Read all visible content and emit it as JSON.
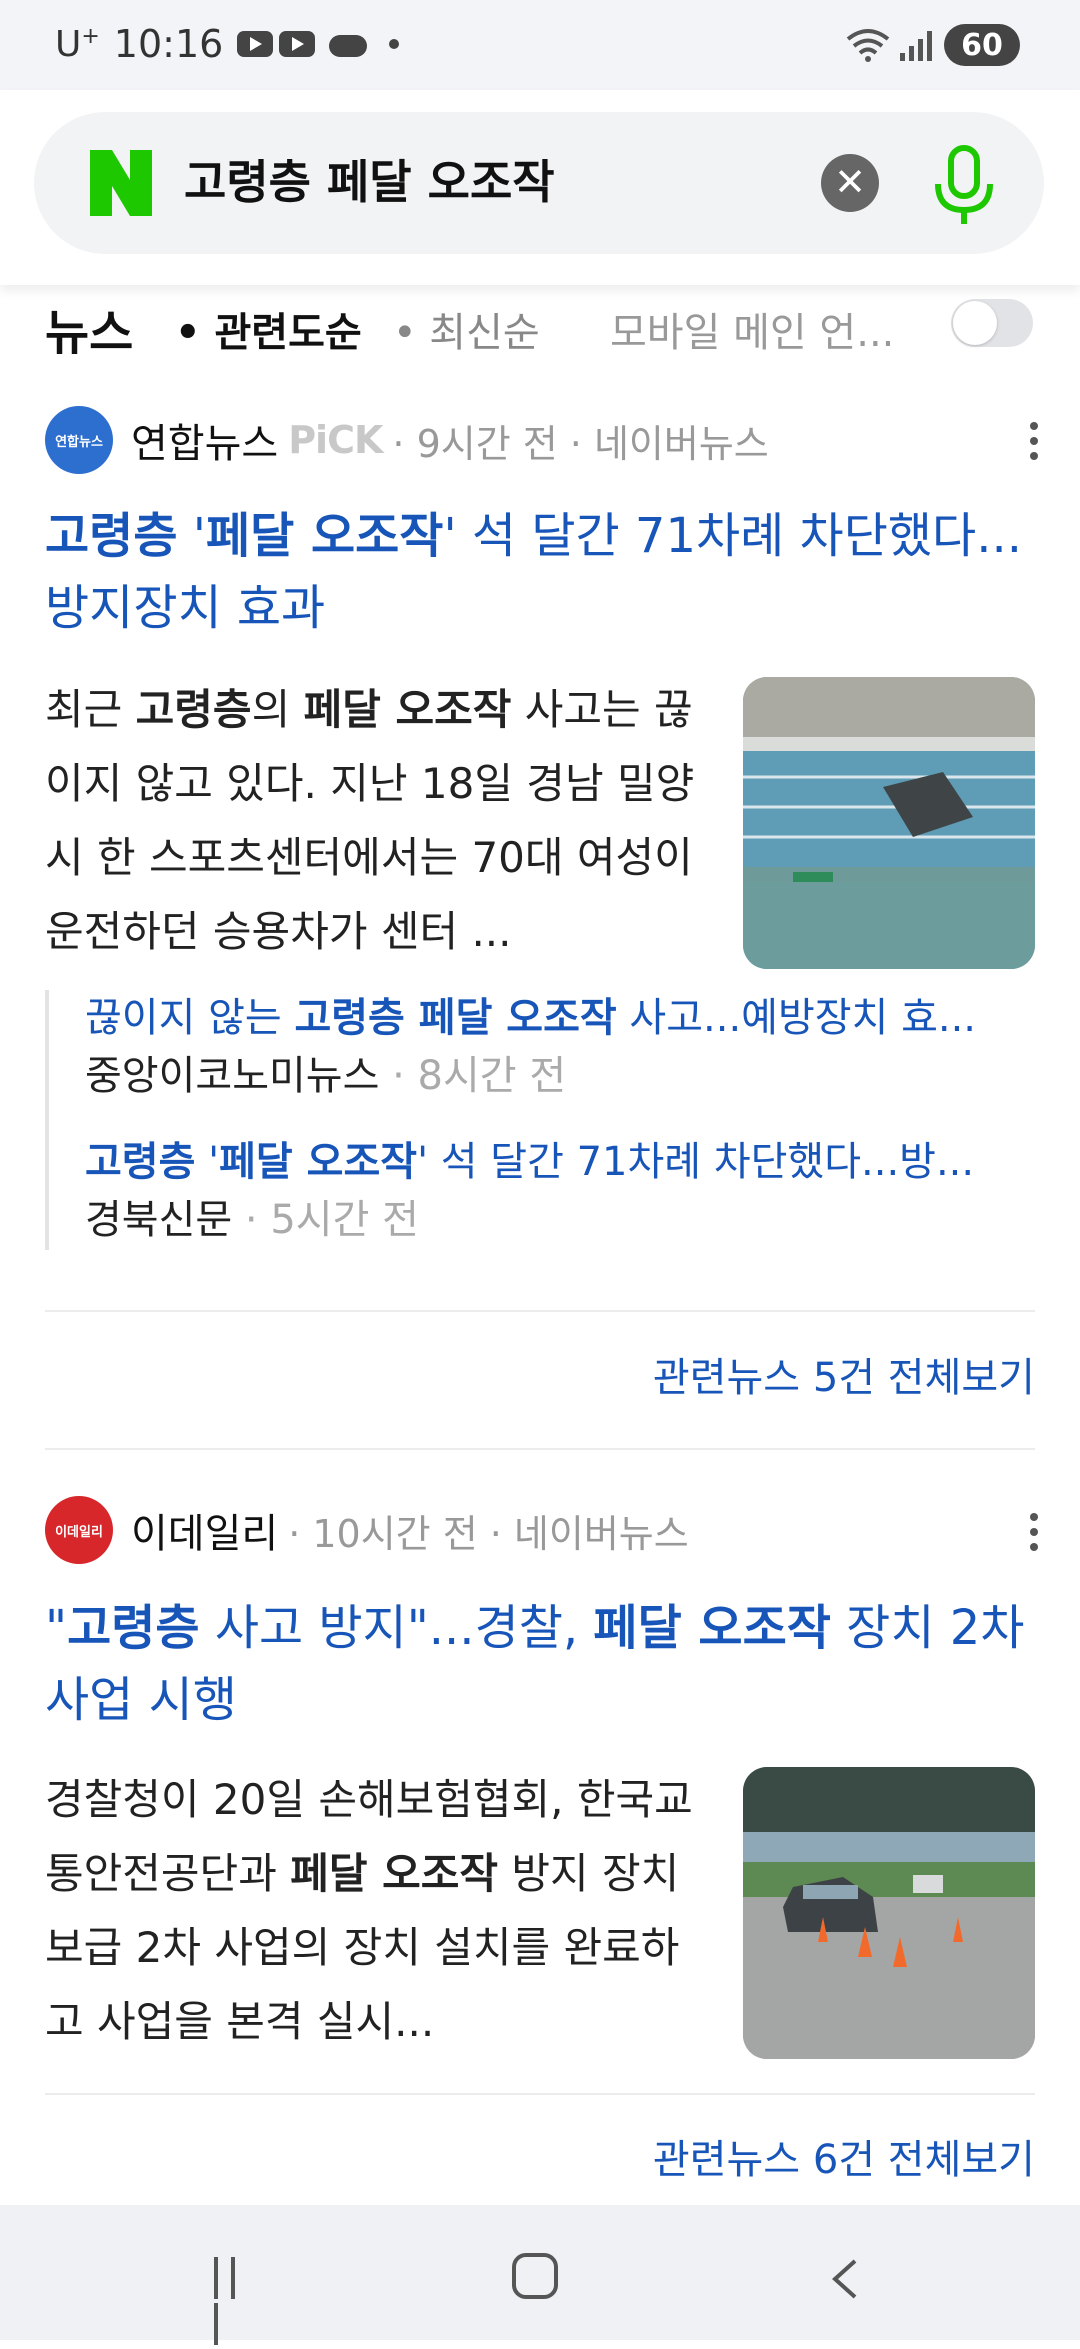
{
  "status_bar": {
    "carrier": "U",
    "carrier_sup": "+",
    "time": "10:16",
    "battery": "60"
  },
  "search": {
    "query": "고령층 페달 오조작",
    "clear_icon": "close-icon",
    "mic_icon": "microphone-icon"
  },
  "filters": {
    "title": "뉴스",
    "sort_relevance": "• 관련도순",
    "sort_latest": "• 최신순",
    "mobile_main": "모바일 메인 언..."
  },
  "articles": [
    {
      "logo_text": "연합뉴스",
      "logo_color": "#2c6fcf",
      "source": "연합뉴스",
      "pick": "PiCK",
      "meta": "· 9시간 전 · 네이버뉴스",
      "headline_parts": [
        "고령층",
        " '",
        "페달 오조작",
        "' 석 달간 71차례 차단했다...방지장치 효과"
      ],
      "body_parts": [
        "최근 ",
        "고령층",
        "의 ",
        "페달 오조작",
        " 사고는 끊이지 않고 있다. 지난 18일 경남 밀양시 한 스포츠센터에서는 70대 여성이 운전하던 승용차가 센터 ..."
      ],
      "related": [
        {
          "title_parts": [
            "끊이지 않는 ",
            "고령층 페달 오조작",
            " 사고...예방장치 효..."
          ],
          "source": "중앙이코노미뉴스",
          "time": " · 8시간 전"
        },
        {
          "title_parts": [
            "고령층",
            " '",
            "페달 오조작",
            "' 석 달간 71차례 차단했다...방..."
          ],
          "source": "경북신문",
          "time": " · 5시간 전"
        }
      ],
      "see_all": "관련뉴스 5건 전체보기"
    },
    {
      "logo_text": "이데일리",
      "logo_color": "#d8272b",
      "source": "이데일리",
      "meta": "· 10시간 전 · 네이버뉴스",
      "headline_parts": [
        "\"",
        "고령층",
        " 사고 방지\"...경찰, ",
        "페달 오조작",
        " 장치 2차 사업 시행"
      ],
      "body_parts": [
        "경찰청이 20일 손해보험협회, 한국교통안전공단과 ",
        "페달 오조작",
        " 방지 장치 보급 2차 사업의 장치 설치를 완료하고 사업을 본격 실시..."
      ],
      "see_all": "관련뉴스 6건 전체보기"
    }
  ]
}
